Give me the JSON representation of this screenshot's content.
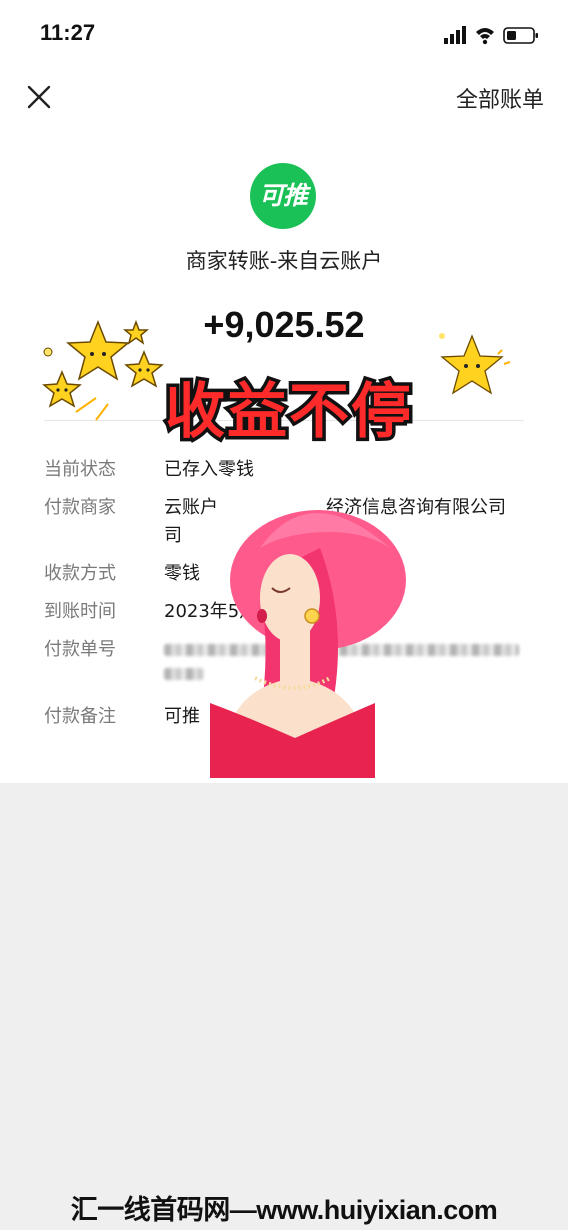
{
  "status_bar": {
    "time": "11:27"
  },
  "nav": {
    "all_bills": "全部账单"
  },
  "merchant": {
    "logo_text": "可推",
    "title": "商家转账-来自云账户",
    "brand_color": "#19c157"
  },
  "amount": "+9,025.52",
  "details": [
    {
      "label": "当前状态",
      "value": "已存入零钱"
    },
    {
      "label": "付款商家",
      "value": "云账户",
      "value_visible_tail": "经济信息咨询有限公司",
      "value_line2": "司"
    },
    {
      "label": "收款方式",
      "value": "零钱"
    },
    {
      "label": "到账时间",
      "value": "2023年5月"
    },
    {
      "label": "付款单号",
      "value": ""
    },
    {
      "label": "付款备注",
      "value": "可推"
    }
  ],
  "overlay": {
    "banner": "收益不停",
    "banner_color": "#ff2a2a"
  },
  "watermark": "汇一线首码网—www.huiyixian.com",
  "icons": [
    "signal-icon",
    "wifi-icon",
    "battery-icon",
    "close-icon",
    "star-icon",
    "woman-illustration"
  ]
}
